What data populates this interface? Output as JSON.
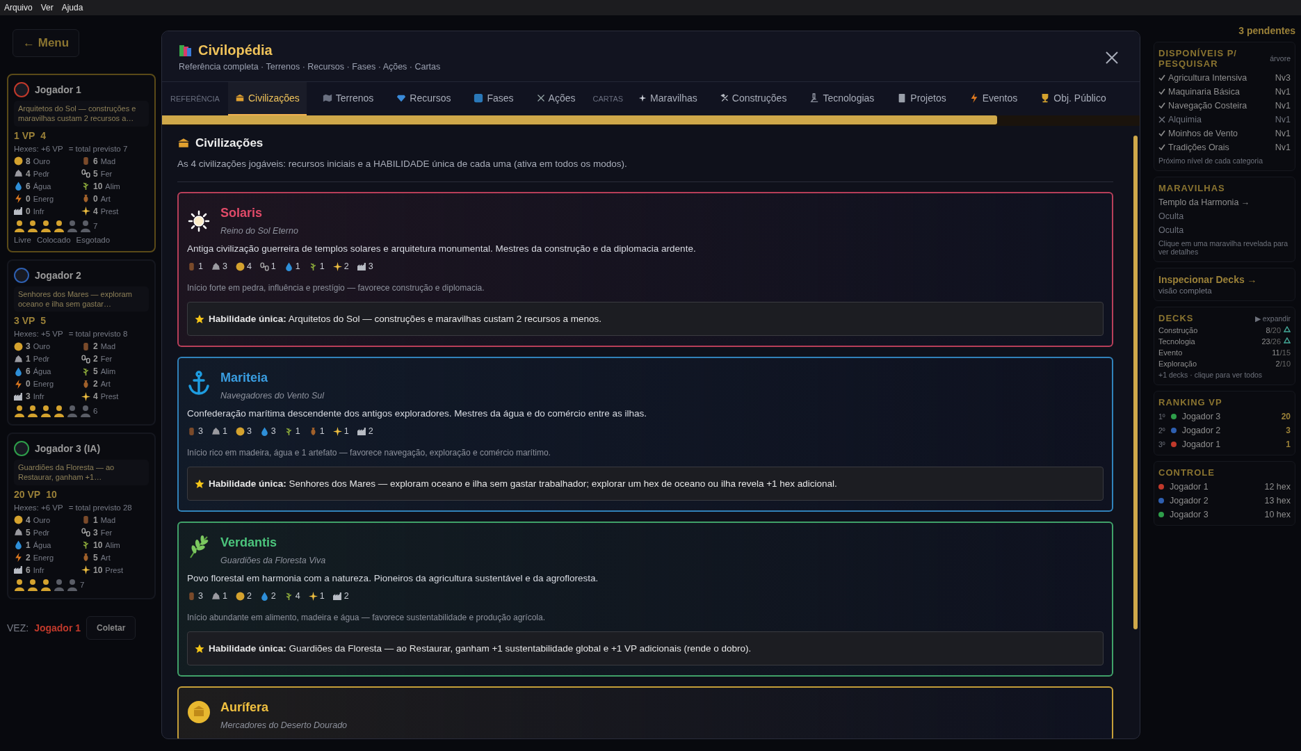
{
  "menu_bar": [
    "Arquivo",
    "Ver",
    "Ajuda"
  ],
  "left_panel": {
    "menu_button": "← Menu",
    "players": [
      {
        "name": "Jogador 1",
        "active": true,
        "color": "#c0392b",
        "ability": "Arquitetos do Sol — construções e maravilhas custam 2 recursos a…",
        "vp": "1 VP",
        "growth": "4",
        "hexes": "Hexes: +6 VP",
        "total": "= total previsto 7",
        "resources": [
          {
            "kind": "gold",
            "amount": "8",
            "unit": "Ouro"
          },
          {
            "kind": "wood",
            "amount": "6",
            "unit": "Mad"
          },
          {
            "kind": "stone",
            "amount": "4",
            "unit": "Pedr"
          },
          {
            "kind": "iron",
            "amount": "5",
            "unit": "Fer"
          },
          {
            "kind": "water",
            "amount": "6",
            "unit": "Água"
          },
          {
            "kind": "food",
            "amount": "10",
            "unit": "Alim"
          },
          {
            "kind": "energy",
            "amount": "0",
            "unit": "Energ"
          },
          {
            "kind": "artifact",
            "amount": "0",
            "unit": "Art"
          },
          {
            "kind": "infra",
            "amount": "0",
            "unit": "Infr"
          },
          {
            "kind": "prestige",
            "amount": "4",
            "unit": "Prest"
          }
        ],
        "workers": [
          {
            "free": true
          },
          {
            "free": true
          },
          {
            "free": true
          },
          {
            "free": true
          },
          {
            "free": false
          },
          {
            "free": false
          }
        ],
        "cards": "7",
        "legend": [
          "Livre",
          "Colocado",
          "Esgotado"
        ]
      },
      {
        "name": "Jogador 2",
        "active": false,
        "color": "#2e5fb0",
        "ability": "Senhores dos Mares — exploram oceano e ilha sem gastar…",
        "vp": "3 VP",
        "growth": "5",
        "hexes": "Hexes: +5 VP",
        "total": "= total previsto 8",
        "resources": [
          {
            "kind": "gold",
            "amount": "3",
            "unit": "Ouro"
          },
          {
            "kind": "wood",
            "amount": "2",
            "unit": "Mad"
          },
          {
            "kind": "stone",
            "amount": "1",
            "unit": "Pedr"
          },
          {
            "kind": "iron",
            "amount": "2",
            "unit": "Fer"
          },
          {
            "kind": "water",
            "amount": "6",
            "unit": "Água"
          },
          {
            "kind": "food",
            "amount": "5",
            "unit": "Alim"
          },
          {
            "kind": "energy",
            "amount": "0",
            "unit": "Energ"
          },
          {
            "kind": "artifact",
            "amount": "2",
            "unit": "Art"
          },
          {
            "kind": "infra",
            "amount": "3",
            "unit": "Infr"
          },
          {
            "kind": "prestige",
            "amount": "4",
            "unit": "Prest"
          }
        ],
        "workers": [
          {
            "free": true
          },
          {
            "free": true
          },
          {
            "free": true
          },
          {
            "free": true
          },
          {
            "free": false
          },
          {
            "free": false
          }
        ],
        "cards": "6"
      },
      {
        "name": "Jogador 3 (IA)",
        "active": false,
        "color": "#2e9e4a",
        "ability": "Guardiões da Floresta — ao Restaurar, ganham +1…",
        "vp": "20 VP",
        "growth": "10",
        "hexes": "Hexes: +6 VP",
        "total": "= total previsto 28",
        "resources": [
          {
            "kind": "gold",
            "amount": "4",
            "unit": "Ouro"
          },
          {
            "kind": "wood",
            "amount": "1",
            "unit": "Mad"
          },
          {
            "kind": "stone",
            "amount": "5",
            "unit": "Pedr"
          },
          {
            "kind": "iron",
            "amount": "3",
            "unit": "Fer"
          },
          {
            "kind": "water",
            "amount": "1",
            "unit": "Água"
          },
          {
            "kind": "food",
            "amount": "10",
            "unit": "Alim"
          },
          {
            "kind": "energy",
            "amount": "2",
            "unit": "Energ"
          },
          {
            "kind": "artifact",
            "amount": "5",
            "unit": "Art"
          },
          {
            "kind": "infra",
            "amount": "6",
            "unit": "Infr"
          },
          {
            "kind": "prestige",
            "amount": "10",
            "unit": "Prest"
          }
        ],
        "workers": [
          {
            "free": true
          },
          {
            "free": true
          },
          {
            "free": true
          },
          {
            "free": false
          },
          {
            "free": false
          }
        ],
        "cards": "7"
      }
    ],
    "turn_label": "VEZ:",
    "turn_player": "Jogador 1",
    "collect_button": "Coletar"
  },
  "right_panel": {
    "pending": "3 pendentes",
    "research": {
      "title": "DISPONÍVEIS P/ PESQUISAR",
      "link": "árvore",
      "items": [
        {
          "name": "Agricultura Intensiva",
          "tier": "Nv3",
          "available": true
        },
        {
          "name": "Maquinaria Básica",
          "tier": "Nv1",
          "available": true
        },
        {
          "name": "Navegação Costeira",
          "tier": "Nv1",
          "available": true
        },
        {
          "name": "Alquimia",
          "tier": "Nv1",
          "available": false
        },
        {
          "name": "Moinhos de Vento",
          "tier": "Nv1",
          "available": true
        },
        {
          "name": "Tradições Orais",
          "tier": "Nv1",
          "available": true
        }
      ],
      "hint": "Próximo nível de cada categoria"
    },
    "wonders": {
      "title": "MARAVILHAS",
      "items": [
        {
          "name": "Templo da Harmonia →",
          "revealed": true
        },
        {
          "name": "Oculta",
          "revealed": false
        },
        {
          "name": "Oculta",
          "revealed": false
        }
      ],
      "hint": "Clique em uma maravilha revelada para ver detalhes"
    },
    "inspect": {
      "title": "Inspecionar Decks →",
      "subtitle": "visão completa"
    },
    "decks": {
      "title": "DECKS",
      "toggle": "▶ expandir",
      "items": [
        {
          "name": "Construção",
          "count": "8",
          "total": "/20",
          "reshuffle": true
        },
        {
          "name": "Tecnologia",
          "count": "23",
          "total": "/26",
          "reshuffle": true
        },
        {
          "name": "Evento",
          "count": "11",
          "total": "/15",
          "reshuffle": false
        },
        {
          "name": "Exploração",
          "count": "2",
          "total": "/10",
          "reshuffle": false
        }
      ],
      "more": "+1 decks · clique para ver todos"
    },
    "ranking": {
      "title": "RANKING VP",
      "rows": [
        {
          "place": "1º",
          "name": "Jogador 3",
          "color": "#2e9e4a",
          "vp": "20"
        },
        {
          "place": "2º",
          "name": "Jogador 2",
          "color": "#2e5fb0",
          "vp": "3"
        },
        {
          "place": "3º",
          "name": "Jogador 1",
          "color": "#c0392b",
          "vp": "1"
        }
      ]
    },
    "control": {
      "title": "CONTROLE",
      "rows": [
        {
          "name": "Jogador 1",
          "color": "#c0392b",
          "hexes": "12 hex"
        },
        {
          "name": "Jogador 2",
          "color": "#2e5fb0",
          "hexes": "13 hex"
        },
        {
          "name": "Jogador 3",
          "color": "#2e9e4a",
          "hexes": "10 hex"
        }
      ]
    }
  },
  "modal": {
    "title": "Civilopédia",
    "subtitle": "Referência completa · Terrenos · Recursos · Fases · Ações · Cartas",
    "tab_groups": [
      {
        "label": "REFERÊNCIA",
        "tabs": [
          {
            "label": "Civilizações",
            "selected": true
          },
          {
            "label": "Terrenos",
            "selected": false
          },
          {
            "label": "Recursos",
            "selected": false
          },
          {
            "label": "Fases",
            "selected": false
          },
          {
            "label": "Ações",
            "selected": false
          }
        ]
      },
      {
        "label": "CARTAS",
        "tabs": [
          {
            "label": "Maravilhas",
            "selected": false
          },
          {
            "label": "Construções",
            "selected": false
          },
          {
            "label": "Tecnologias",
            "selected": false
          },
          {
            "label": "Projetos",
            "selected": false
          },
          {
            "label": "Eventos",
            "selected": false
          },
          {
            "label": "Obj. Público",
            "selected": false
          }
        ]
      }
    ],
    "section": {
      "title": "Civilizações",
      "description": "As 4 civilizações jogáveis: recursos iniciais e a HABILIDADE única de cada uma (ativa em todos os modos).",
      "civilizations": [
        {
          "name": "Solaris",
          "subtitle": "Reino do Sol Eterno",
          "color": "#e04a68",
          "description": "Antiga civilização guerreira de templos solares e arquitetura monumental. Mestres da construção e da diplomacia ardente.",
          "resources": [
            {
              "kind": "wood",
              "value": "1"
            },
            {
              "kind": "stone",
              "value": "3"
            },
            {
              "kind": "gold",
              "value": "4"
            },
            {
              "kind": "iron",
              "value": "1"
            },
            {
              "kind": "water",
              "value": "1"
            },
            {
              "kind": "food",
              "value": "1"
            },
            {
              "kind": "prestige",
              "value": "2"
            },
            {
              "kind": "infra",
              "value": "3"
            }
          ],
          "note": "Início forte em pedra, influência e prestígio — favorece construção e diplomacia.",
          "ability": "**Habilidade única:** Arquitetos do Sol — construções e maravilhas custam 2 recursos a menos."
        },
        {
          "name": "Mariteia",
          "subtitle": "Navegadores do Vento Sul",
          "color": "#3a9de0",
          "description": "Confederação marítima descendente dos antigos exploradores. Mestres da água e do comércio entre as ilhas.",
          "resources": [
            {
              "kind": "wood",
              "value": "3"
            },
            {
              "kind": "stone",
              "value": "1"
            },
            {
              "kind": "gold",
              "value": "3"
            },
            {
              "kind": "water",
              "value": "3"
            },
            {
              "kind": "food",
              "value": "1"
            },
            {
              "kind": "artifact",
              "value": "1"
            },
            {
              "kind": "prestige",
              "value": "1"
            },
            {
              "kind": "infra",
              "value": "2"
            }
          ],
          "note": "Início rico em madeira, água e 1 artefato — favorece navegação, exploração e comércio marítimo.",
          "ability": "**Habilidade única:** Senhores dos Mares — exploram oceano e ilha sem gastar trabalhador; explorar um hex de oceano ou ilha revela +1 hex adicional."
        },
        {
          "name": "Verdantis",
          "subtitle": "Guardiões da Floresta Viva",
          "color": "#4cc47c",
          "description": "Povo florestal em harmonia com a natureza. Pioneiros da agricultura sustentável e da agrofloresta.",
          "resources": [
            {
              "kind": "wood",
              "value": "3"
            },
            {
              "kind": "stone",
              "value": "1"
            },
            {
              "kind": "gold",
              "value": "2"
            },
            {
              "kind": "water",
              "value": "2"
            },
            {
              "kind": "food",
              "value": "4"
            },
            {
              "kind": "prestige",
              "value": "1"
            },
            {
              "kind": "infra",
              "value": "2"
            }
          ],
          "note": "Início abundante em alimento, madeira e água — favorece sustentabilidade e produção agrícola.",
          "ability": "**Habilidade única:** Guardiões da Floresta — ao Restaurar, ganham +1 sustentabilidade global e +1 VP adicionais (rende o dobro)."
        },
        {
          "name": "Aurífera",
          "subtitle": "Mercadores do Deserto Dourado",
          "color": "#f0c040"
        }
      ]
    }
  }
}
